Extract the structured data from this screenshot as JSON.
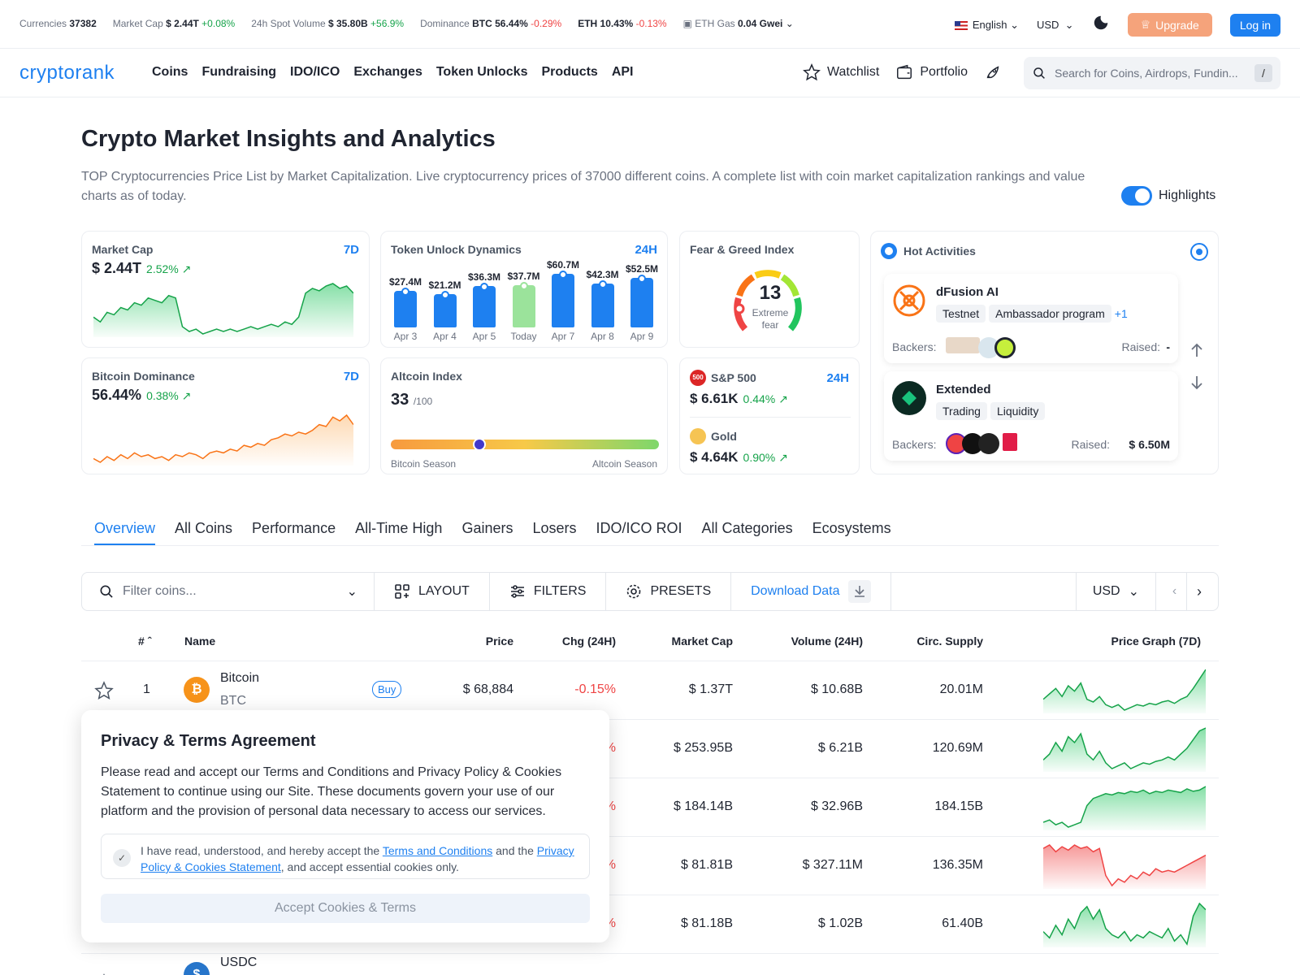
{
  "topbar": {
    "stats": [
      {
        "label": "Currencies",
        "value": "37382",
        "change": ""
      },
      {
        "label": "Market Cap",
        "value": "$ 2.44T",
        "change": "+0.08%"
      },
      {
        "label": "24h Spot Volume",
        "value": "$ 35.80B",
        "change": "+56.9%"
      },
      {
        "label": "Dominance",
        "value": "BTC 56.44%",
        "change": "-0.29%"
      },
      {
        "label": "",
        "value": "ETH 10.43%",
        "change": "-0.13%"
      },
      {
        "label": "ETH Gas",
        "value": "0.04 Gwei",
        "change": ""
      }
    ],
    "language": "English",
    "currency": "USD",
    "upgrade": "Upgrade",
    "login": "Log in"
  },
  "nav": {
    "logo": "cryptorank",
    "links": [
      "Coins",
      "Fundraising",
      "IDO/ICO",
      "Exchanges",
      "Token Unlocks",
      "Products",
      "API"
    ],
    "watchlist": "Watchlist",
    "portfolio": "Portfolio",
    "search_placeholder": "Search for Coins, Airdrops, Fundin...",
    "search_key": "/"
  },
  "hero": {
    "title": "Crypto Market Insights and Analytics",
    "description": "TOP Cryptocurrencies Price List by Market Capitalization. Live cryptocurrency prices of 37000 different coins. A complete list with coin market capitalization rankings and value charts as of today.",
    "highlights": "Highlights",
    "highlights_on": true
  },
  "cards": {
    "market_cap": {
      "title": "Market Cap",
      "period": "7D",
      "value": "$ 2.44T",
      "change": "2.52%"
    },
    "btc_dominance": {
      "title": "Bitcoin Dominance",
      "period": "7D",
      "value": "56.44%",
      "change": "0.38%"
    },
    "token_unlock": {
      "title": "Token Unlock Dynamics",
      "period": "24H"
    },
    "fear_greed": {
      "title": "Fear & Greed Index",
      "value": "13",
      "label_1": "Extreme",
      "label_2": "fear"
    },
    "altcoin": {
      "title": "Altcoin Index",
      "value": "33",
      "max": "/100",
      "left": "Bitcoin Season",
      "right": "Altcoin Season",
      "level": 0.33
    },
    "sp500": {
      "title": "S&P 500",
      "period": "24H",
      "value": "$ 6.61K",
      "change": "0.44%",
      "badge": "500"
    },
    "gold": {
      "title": "Gold",
      "value": "$ 4.64K",
      "change": "0.90%"
    },
    "hot": {
      "title": "Hot Activities",
      "items": [
        {
          "name": "dFusion AI",
          "tags": [
            "Testnet",
            "Ambassador program"
          ],
          "more": "+1",
          "backers_label": "Backers:",
          "raised_label": "Raised:",
          "raised": "-"
        },
        {
          "name": "Extended",
          "tags": [
            "Trading",
            "Liquidity"
          ],
          "more": "",
          "backers_label": "Backers:",
          "raised_label": "Raised:",
          "raised": "$ 6.50M"
        }
      ]
    }
  },
  "chart_data": [
    {
      "type": "bar",
      "title": "Token Unlock Dynamics",
      "categories": [
        "Apr 3",
        "Apr 4",
        "Apr 5",
        "Today",
        "Apr 7",
        "Apr 8",
        "Apr 9"
      ],
      "values": [
        27.4,
        21.2,
        36.3,
        37.7,
        60.7,
        42.3,
        52.5
      ],
      "labels": [
        "$27.4M",
        "$21.2M",
        "$36.3M",
        "$37.7M",
        "$60.7M",
        "$42.3M",
        "$52.5M"
      ],
      "highlight_index": 3
    },
    {
      "type": "line",
      "title": "Market Cap",
      "values": [
        42,
        40,
        44,
        43,
        46,
        45,
        48,
        47,
        50,
        49,
        48,
        51,
        50,
        38,
        36,
        37,
        35,
        36,
        37,
        36,
        37,
        36,
        37,
        38,
        37,
        38,
        39,
        38,
        40,
        39,
        42,
        52,
        54,
        53,
        55,
        56,
        54,
        55,
        52
      ]
    },
    {
      "type": "line",
      "title": "Bitcoin Dominance",
      "values": [
        30,
        28,
        31,
        29,
        32,
        30,
        33,
        31,
        32,
        30,
        31,
        29,
        32,
        31,
        33,
        32,
        30,
        33,
        34,
        33,
        35,
        34,
        37,
        36,
        38,
        37,
        40,
        41,
        43,
        42,
        44,
        43,
        45,
        48,
        47,
        52,
        50,
        53,
        48
      ]
    }
  ],
  "tabs": [
    "Overview",
    "All Coins",
    "Performance",
    "All-Time High",
    "Gainers",
    "Losers",
    "IDO/ICO ROI",
    "All Categories",
    "Ecosystems"
  ],
  "toolbar": {
    "filter_placeholder": "Filter coins...",
    "layout": "LAYOUT",
    "filters": "FILTERS",
    "presets": "PRESETS",
    "download": "Download Data",
    "currency": "USD"
  },
  "table": {
    "headers": {
      "rank": "#",
      "name": "Name",
      "price": "Price",
      "chg": "Chg (24H)",
      "mcap": "Market Cap",
      "volume": "Volume (24H)",
      "supply": "Circ. Supply",
      "graph": "Price Graph (7D)"
    },
    "rows": [
      {
        "rank": "1",
        "name": "Bitcoin",
        "symbol": "BTC",
        "buy": "Buy",
        "price": "$ 68,884",
        "chg": "-0.15%",
        "mcap": "$ 1.37T",
        "volume": "$ 10.68B",
        "supply": "20.01M",
        "trend": "up",
        "spark": [
          20,
          24,
          28,
          22,
          30,
          26,
          32,
          20,
          18,
          22,
          16,
          14,
          16,
          12,
          14,
          16,
          15,
          17,
          16,
          18,
          19,
          17,
          20,
          22,
          28,
          35,
          42
        ]
      },
      {
        "rank": "",
        "name": "",
        "symbol": "",
        "buy": "",
        "price": "",
        "chg": "%",
        "mcap": "$ 253.95B",
        "volume": "$ 6.21B",
        "supply": "120.69M",
        "trend": "up",
        "spark": [
          18,
          22,
          30,
          24,
          34,
          30,
          36,
          22,
          18,
          24,
          16,
          12,
          14,
          16,
          12,
          14,
          16,
          15,
          17,
          18,
          20,
          18,
          22,
          26,
          32,
          38,
          40
        ]
      },
      {
        "rank": "",
        "name": "",
        "symbol": "",
        "buy": "",
        "price": "",
        "chg": "%",
        "mcap": "$ 184.14B",
        "volume": "$ 32.96B",
        "supply": "184.15B",
        "trend": "up",
        "spark": [
          10,
          12,
          8,
          10,
          6,
          8,
          10,
          24,
          30,
          32,
          34,
          33,
          35,
          34,
          36,
          35,
          37,
          34,
          36,
          35,
          37,
          36,
          35,
          38,
          36,
          37,
          40
        ]
      },
      {
        "rank": "",
        "name": "",
        "symbol": "",
        "buy": "",
        "price": "",
        "chg": "%",
        "mcap": "$ 81.81B",
        "volume": "$ 327.11M",
        "supply": "136.35M",
        "trend": "down",
        "spark": [
          36,
          38,
          34,
          37,
          35,
          38,
          36,
          37,
          34,
          36,
          20,
          14,
          18,
          16,
          20,
          18,
          22,
          20,
          24,
          22,
          23,
          22,
          24,
          26,
          28,
          30,
          32
        ]
      },
      {
        "rank": "",
        "name": "",
        "symbol": "",
        "buy": "",
        "price": "",
        "chg": "%",
        "mcap": "$ 81.18B",
        "volume": "$ 1.02B",
        "supply": "61.40B",
        "trend": "up",
        "spark": [
          20,
          16,
          24,
          18,
          28,
          22,
          32,
          36,
          28,
          34,
          22,
          18,
          16,
          20,
          14,
          18,
          16,
          20,
          18,
          16,
          22,
          14,
          18,
          12,
          30,
          38,
          34
        ]
      },
      {
        "rank": "",
        "name": "USDC",
        "symbol": "",
        "buy": "",
        "price": "",
        "chg": "",
        "mcap": "",
        "volume": "",
        "supply": "",
        "trend": "up",
        "spark": [
          4,
          6,
          8,
          6,
          10,
          8,
          12,
          6,
          8,
          10,
          12,
          14,
          10,
          12,
          16,
          14
        ]
      }
    ]
  },
  "modal": {
    "title": "Privacy & Terms Agreement",
    "body": "Please read and accept our Terms and Conditions and Privacy Policy & Cookies Statement to continue using our Site. These documents govern your use of our platform and the provision of personal data necessary to access our services.",
    "consent_pre": "I have read, understood, and hereby accept the ",
    "terms_link": "Terms and Conditions",
    "consent_mid": " and the ",
    "privacy_link": "Privacy Policy & Cookies Statement",
    "consent_post": ", and accept essential cookies only.",
    "accept": "Accept Cookies & Terms"
  },
  "colors": {
    "accent": "#1e80f0",
    "positive": "#16a34a",
    "negative": "#ef4444",
    "upgrade": "#f5a37b"
  }
}
